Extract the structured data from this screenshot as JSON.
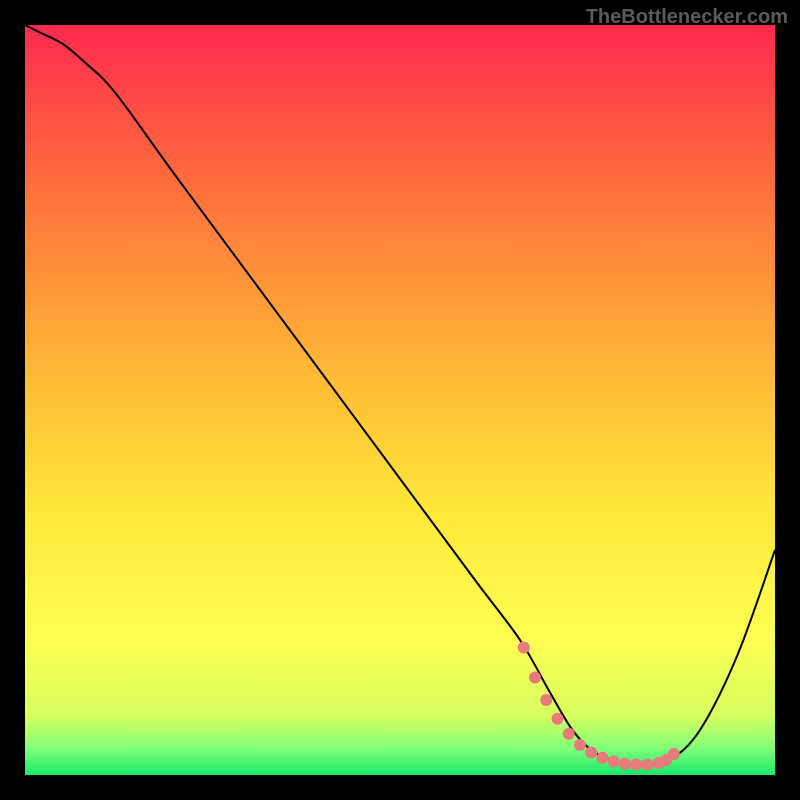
{
  "watermark": "TheBottlenecker.com",
  "chart_data": {
    "type": "line",
    "title": "",
    "xlabel": "",
    "ylabel": "",
    "xlim": [
      0,
      100
    ],
    "ylim": [
      0,
      100
    ],
    "background_gradient": [
      {
        "stop": 0.0,
        "color": "#ff2a4f"
      },
      {
        "stop": 0.2,
        "color": "#ff6a3c"
      },
      {
        "stop": 0.45,
        "color": "#ffb536"
      },
      {
        "stop": 0.65,
        "color": "#ffe838"
      },
      {
        "stop": 0.82,
        "color": "#fdff52"
      },
      {
        "stop": 0.92,
        "color": "#d7ff5e"
      },
      {
        "stop": 0.965,
        "color": "#7fff78"
      },
      {
        "stop": 1.0,
        "color": "#17e86a"
      }
    ],
    "series": [
      {
        "name": "bottleneck-curve",
        "color": "#000000",
        "width": 2,
        "x": [
          0,
          2,
          5,
          8,
          12,
          20,
          30,
          40,
          50,
          60,
          66,
          70,
          73,
          76,
          80,
          83,
          86,
          90,
          95,
          100
        ],
        "y": [
          100,
          99,
          97.5,
          95,
          91,
          80,
          66.5,
          53,
          39.5,
          26,
          18,
          11,
          6,
          3,
          1.5,
          1.3,
          2,
          6,
          16,
          30
        ]
      }
    ],
    "markers": {
      "name": "optimal-range",
      "color": "#e77b7b",
      "size": 6,
      "x": [
        66.5,
        68,
        69.5,
        71,
        72.5,
        74,
        75.5,
        77,
        78.5,
        80,
        81.5,
        83,
        84.5,
        85.5,
        86.5
      ],
      "y": [
        17,
        13,
        10,
        7.5,
        5.5,
        4,
        3,
        2.3,
        1.8,
        1.5,
        1.4,
        1.4,
        1.6,
        2.0,
        2.8
      ]
    }
  }
}
